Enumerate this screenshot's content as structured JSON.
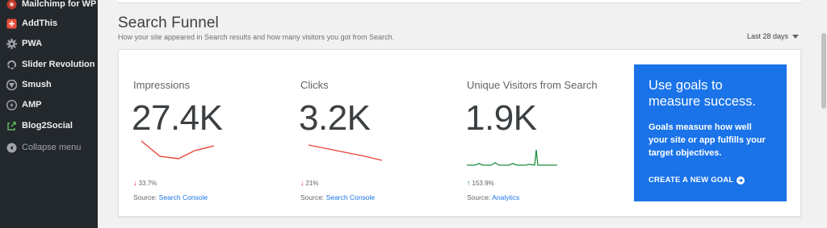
{
  "sidebar": {
    "items": [
      {
        "label": "Mailchimp for WP",
        "icon": "mailchimp-icon"
      },
      {
        "label": "AddThis",
        "icon": "addthis-icon"
      },
      {
        "label": "PWA",
        "icon": "gear-icon"
      },
      {
        "label": "Slider Revolution",
        "icon": "slider-revolution-icon"
      },
      {
        "label": "Smush",
        "icon": "smush-icon"
      },
      {
        "label": "AMP",
        "icon": "amp-icon"
      },
      {
        "label": "Blog2Social",
        "icon": "blog2social-icon"
      }
    ],
    "collapse_label": "Collapse menu"
  },
  "section": {
    "title": "Search Funnel",
    "description": "How your site appeared in Search results and how many visitors you got from Search.",
    "date_range": "Last 28 days"
  },
  "metrics": [
    {
      "label": "Impressions",
      "value": "27.4K",
      "change": "33.7%",
      "direction": "down",
      "source_prefix": "Source:",
      "source_link": "Search Console",
      "trend_color": "#ea4335"
    },
    {
      "label": "Clicks",
      "value": "3.2K",
      "change": "21%",
      "direction": "down",
      "source_prefix": "Source:",
      "source_link": "Search Console",
      "trend_color": "#ea4335"
    },
    {
      "label": "Unique Visitors from Search",
      "value": "1.9K",
      "change": "153.9%",
      "direction": "up",
      "source_prefix": "Source:",
      "source_link": "Analytics",
      "trend_color": "#34a853"
    }
  ],
  "cta": {
    "title": "Use goals to measure success.",
    "text": "Goals measure how well your site or app fulfills your target objectives.",
    "link": "CREATE A NEW GOAL",
    "background": "#1a73e8"
  }
}
